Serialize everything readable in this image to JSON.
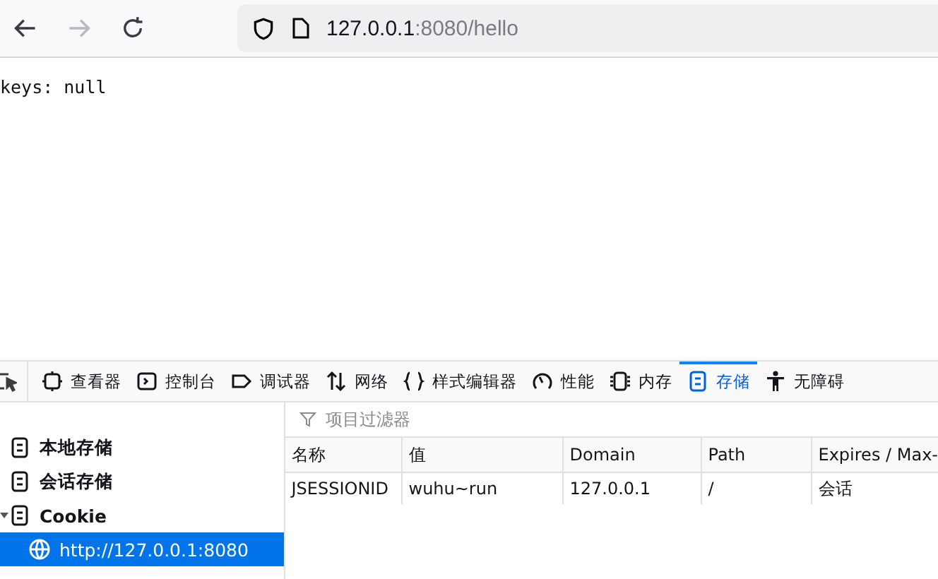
{
  "browser": {
    "back_disabled": false,
    "forward_disabled": true,
    "url_host": "127.0.0.1",
    "url_rest": ":8080/hello"
  },
  "page": {
    "text": "keys: null"
  },
  "devtools": {
    "tabs": [
      {
        "kind": "inspector",
        "label": "查看器",
        "selected": false
      },
      {
        "kind": "console",
        "label": "控制台",
        "selected": false
      },
      {
        "kind": "debugger",
        "label": "调试器",
        "selected": false
      },
      {
        "kind": "network",
        "label": "网络",
        "selected": false
      },
      {
        "kind": "style",
        "label": "样式编辑器",
        "selected": false
      },
      {
        "kind": "performance",
        "label": "性能",
        "selected": false
      },
      {
        "kind": "memory",
        "label": "内存",
        "selected": false
      },
      {
        "kind": "storage",
        "label": "存储",
        "selected": true
      },
      {
        "kind": "accessibility",
        "label": "无障碍",
        "selected": false
      }
    ],
    "tree": [
      {
        "label": "本地存储",
        "expanded": false,
        "selected": false
      },
      {
        "label": "会话存储",
        "expanded": false,
        "selected": false
      },
      {
        "label": "Cookie",
        "expanded": true,
        "selected": false,
        "children": [
          {
            "label": "http://127.0.0.1:8080",
            "selected": true
          }
        ]
      }
    ],
    "filter": {
      "placeholder": "项目过滤器"
    },
    "table": {
      "columns": [
        "名称",
        "值",
        "Domain",
        "Path",
        "Expires / Max-"
      ],
      "rows": [
        [
          "JSESSIONID",
          "wuhu~run",
          "127.0.0.1",
          "/",
          "会话"
        ]
      ]
    }
  }
}
